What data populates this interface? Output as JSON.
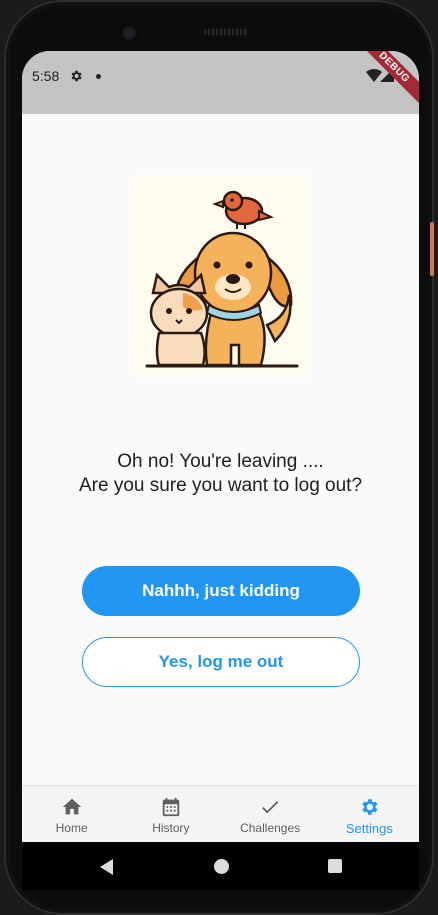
{
  "status": {
    "time": "5:58",
    "debug_label": "DEBUG"
  },
  "main": {
    "message_line1": "Oh no! You're leaving ....",
    "message_line2": "Are you sure you want to log out?",
    "stay_button": "Nahhh, just kidding",
    "logout_button": "Yes, log me out"
  },
  "nav": {
    "items": [
      {
        "label": "Home",
        "icon": "home-icon",
        "active": false
      },
      {
        "label": "History",
        "icon": "calendar-icon",
        "active": false
      },
      {
        "label": "Challenges",
        "icon": "check-icon",
        "active": false
      },
      {
        "label": "Settings",
        "icon": "gear-icon",
        "active": true
      }
    ]
  },
  "colors": {
    "accent": "#2196f3",
    "statusbar": "#c4c4c4",
    "debug_banner": "#a52a35"
  }
}
